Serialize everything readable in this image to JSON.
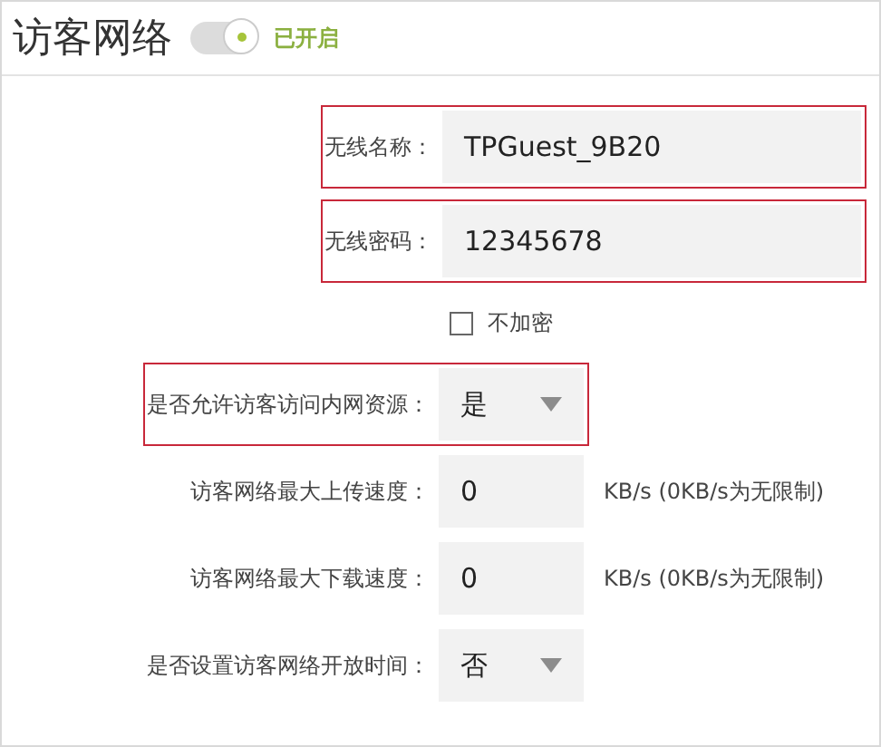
{
  "header": {
    "title": "访客网络",
    "toggle": {
      "on": true
    },
    "status": "已开启"
  },
  "fields": [
    {
      "kind": "text",
      "label": "无线名称：",
      "value": "TPGuest_9B20",
      "highlighted": true
    },
    {
      "kind": "text",
      "label": "无线密码：",
      "value": "12345678",
      "highlighted": true
    },
    {
      "kind": "checkbox",
      "label": "不加密",
      "checked": false
    },
    {
      "kind": "select",
      "label": "是否允许访客访问内网资源：",
      "value": "是",
      "highlighted": true
    },
    {
      "kind": "speed",
      "label": "访客网络最大上传速度：",
      "value": "0",
      "unit": "KB/s (0KB/s为无限制)",
      "highlighted": false
    },
    {
      "kind": "speed",
      "label": "访客网络最大下载速度：",
      "value": "0",
      "unit": "KB/s (0KB/s为无限制)",
      "highlighted": false
    },
    {
      "kind": "select",
      "label": "是否设置访客网络开放时间：",
      "value": "否",
      "highlighted": false
    }
  ]
}
